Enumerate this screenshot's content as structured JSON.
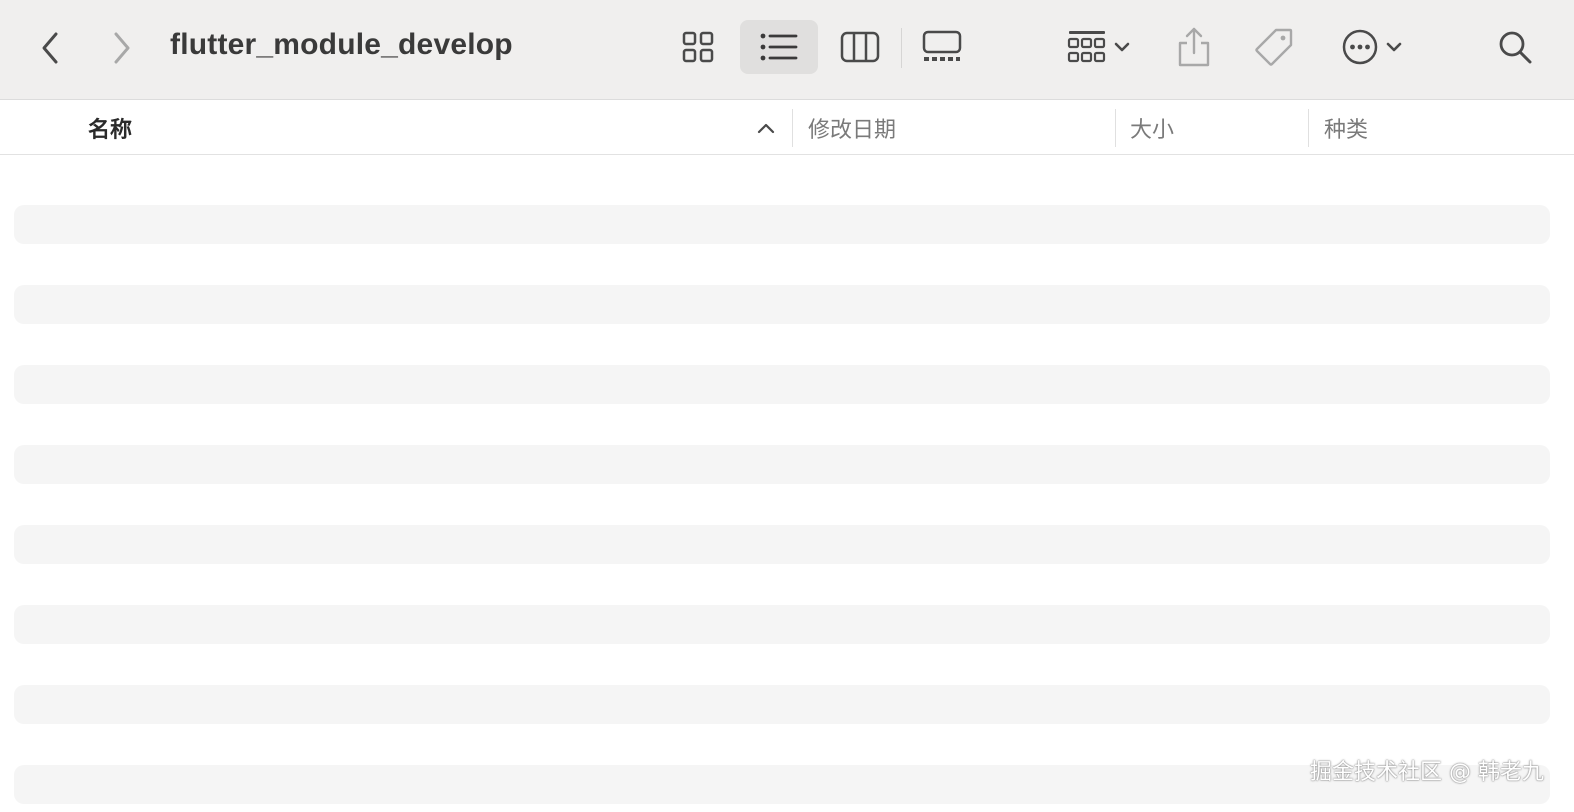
{
  "window": {
    "title": "flutter_module_develop"
  },
  "toolbar": {
    "back_icon": "chevron-left-icon",
    "forward_icon": "chevron-right-icon",
    "view_modes": [
      {
        "name": "icon-view",
        "icon": "grid-icon",
        "selected": false
      },
      {
        "name": "list-view",
        "icon": "list-icon",
        "selected": true
      },
      {
        "name": "column-view",
        "icon": "columns-icon",
        "selected": false
      },
      {
        "name": "gallery-view",
        "icon": "gallery-icon",
        "selected": false
      }
    ],
    "group_icon": "group-grid-icon",
    "share_icon": "share-icon",
    "tag_icon": "tag-icon",
    "more_icon": "ellipsis-circle-icon",
    "search_icon": "search-icon"
  },
  "columns": {
    "name": "名称",
    "date": "修改日期",
    "size": "大小",
    "kind": "种类",
    "sort_direction": "ascending"
  },
  "rows": {
    "count": 8,
    "state": "empty-placeholder"
  },
  "watermark": {
    "text": "掘金技术社区 @ 韩老九"
  },
  "colors": {
    "toolbar_bg": "#f0efee",
    "selected_view_bg": "#e0dfde",
    "row_bg": "#f5f5f5",
    "icon": "#4a4a4a",
    "icon_dim": "#a8a8a8"
  }
}
